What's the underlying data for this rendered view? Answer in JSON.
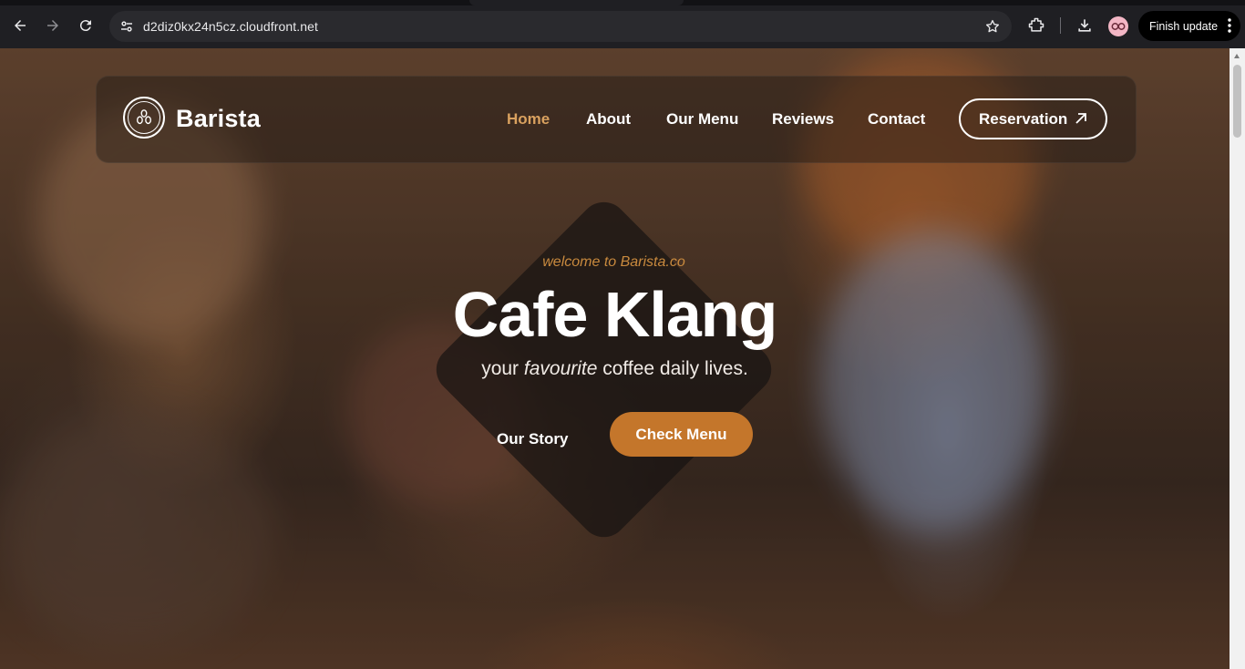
{
  "browser": {
    "url": "d2diz0kx24n5cz.cloudfront.net",
    "finish_update_label": "Finish update"
  },
  "site": {
    "brand": "Barista",
    "nav": [
      {
        "label": "Home",
        "active": true
      },
      {
        "label": "About",
        "active": false
      },
      {
        "label": "Our Menu",
        "active": false
      },
      {
        "label": "Reviews",
        "active": false
      },
      {
        "label": "Contact",
        "active": false
      }
    ],
    "reservation_label": "Reservation",
    "colors": {
      "accent": "#c4762b",
      "active_nav": "#d9a15f",
      "tagline": "#c98a3e"
    }
  },
  "hero": {
    "tagline": "welcome to Barista.co",
    "title": "Cafe Klang",
    "subtitle_before": "your ",
    "subtitle_em": "favourite",
    "subtitle_after": " coffee daily lives.",
    "our_story_label": "Our Story",
    "check_menu_label": "Check Menu"
  }
}
